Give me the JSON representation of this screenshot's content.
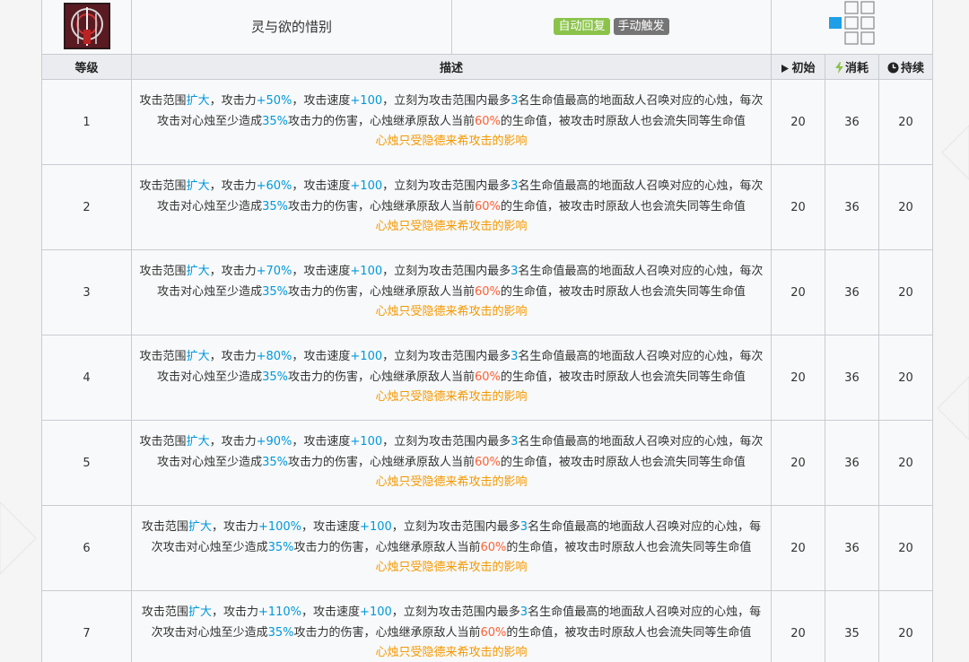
{
  "skill": {
    "name": "灵与欲的惜别",
    "tags": [
      {
        "label": "自动回复",
        "color": "#8bc34a"
      },
      {
        "label": "手动触发",
        "color": "#757575"
      }
    ],
    "range_active_color": "#1e9fe8"
  },
  "headers": {
    "level": "等级",
    "desc": "描述",
    "init": "初始",
    "cost": "消耗",
    "duration": "持续"
  },
  "icons": {
    "init": "play-triangle-icon",
    "cost": "lightning-bolt-icon",
    "duration": "clock-icon",
    "skill": "skill-emblem-icon"
  },
  "desc_parts": {
    "p1": "攻击范围",
    "expand": "扩大",
    "p2": "，攻击力",
    "p3": "，攻击速度",
    "aspd": "+100",
    "p4": "，立刻为攻击范围内最多",
    "count": "3",
    "p5": "名生命值最高的地面敌人召唤对应的心烛，每次攻击对心烛至少造成",
    "dmg": "35%",
    "p6": "攻击力的伤害，心烛继承原敌人当前",
    "hp": "60%",
    "p7": "的生命值，被攻击时原敌人也会流失同等生命值",
    "note": "心烛只受隐德来希攻击的影响"
  },
  "rows": [
    {
      "level": "1",
      "atk": "+50%",
      "init": "20",
      "cost": "36",
      "duration": "20"
    },
    {
      "level": "2",
      "atk": "+60%",
      "init": "20",
      "cost": "36",
      "duration": "20"
    },
    {
      "level": "3",
      "atk": "+70%",
      "init": "20",
      "cost": "36",
      "duration": "20"
    },
    {
      "level": "4",
      "atk": "+80%",
      "init": "20",
      "cost": "36",
      "duration": "20"
    },
    {
      "level": "5",
      "atk": "+90%",
      "init": "20",
      "cost": "36",
      "duration": "20"
    },
    {
      "level": "6",
      "atk": "+100%",
      "init": "20",
      "cost": "36",
      "duration": "20"
    },
    {
      "level": "7",
      "atk": "+110%",
      "init": "20",
      "cost": "35",
      "duration": "20"
    }
  ]
}
